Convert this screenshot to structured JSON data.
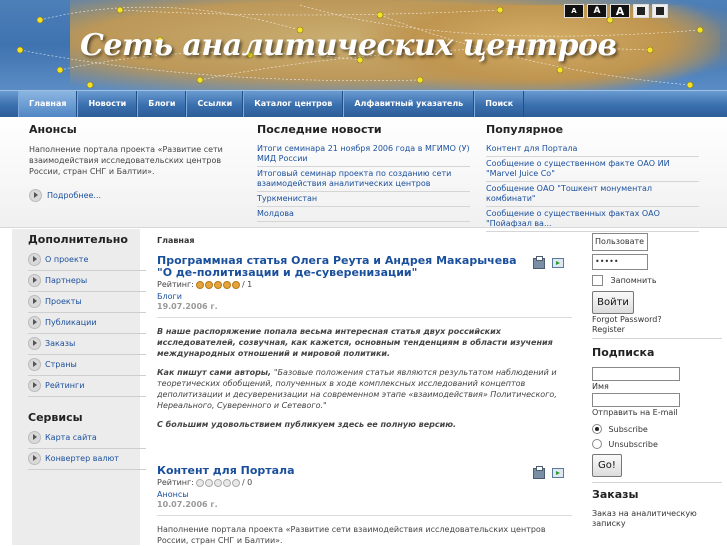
{
  "header": {
    "site_title": "Сеть аналитических центров",
    "font_tools": [
      "A",
      "A",
      "A"
    ]
  },
  "nav": {
    "items": [
      "Главная",
      "Новости",
      "Блоги",
      "Ссылки",
      "Каталог центров",
      "Алфавитный указатель",
      "Поиск"
    ],
    "active": "Главная"
  },
  "topband": {
    "announcements": {
      "title": "Анонсы",
      "text": "Наполнение портала проекта «Развитие сети взаимодействия исследовательских центров России, стран СНГ и Балтии».",
      "more": "Подробнее..."
    },
    "news": {
      "title": "Последние новости",
      "items": [
        "Итоги семинара 21 ноября 2006 года в МГИМО (У) МИД России",
        "Итоговый семинар проекта по созданию сети взаимодействия аналитических центров",
        "Туркменистан",
        "Молдова"
      ]
    },
    "popular": {
      "title": "Популярное",
      "items": [
        "Контент для Портала",
        "Сообщение о существенном факте ОАО ИИ \"Marvel Juice Co\"",
        "Сообщение ОАО \"Тошкент монументал комбинати\"",
        "Сообщение о существенных фактах ОАО \"Пойафзал ва..."
      ]
    }
  },
  "leftcol": {
    "additional": {
      "title": "Дополнительно",
      "items": [
        "О проекте",
        "Партнеры",
        "Проекты",
        "Публикации",
        "Заказы",
        "Страны",
        "Рейтинги"
      ]
    },
    "services": {
      "title": "Сервисы",
      "items": [
        "Карта сайта",
        "Конвертер валют"
      ]
    }
  },
  "main": {
    "breadcrumb": "Главная",
    "articles": [
      {
        "title": "Программная статья Олега Реута и Андрея Макарычева \"О де-политизации и де-суверенизации\"",
        "rating_label": "Рейтинг:",
        "rating_stars": 5,
        "rating_text": "/ 1",
        "category": "Блоги",
        "date": "19.07.2006 г.",
        "lead": "В наше распоряжение попала весьма интересная статья двух российских исследователей, созвучная, как кажется, основным тенденциям в области изучения международных отношений и мировой политики.",
        "quote_intro": "Как пишут сами авторы, ",
        "quote": "\"Базовые положения статьи являются результатом наблюдений и теоретических обобщений, полученных в ходе комплексных исследований концептов деполитизации и десуверенизации на современном этапе «взаимодействия» Политического, Нереального, Суверенного и Сетевого.\"",
        "closing": "С большим удовольствием публикуем здесь ее полную версию."
      },
      {
        "title": "Контент для Портала",
        "rating_label": "Рейтинг:",
        "rating_stars": 0,
        "rating_text": "/ 0",
        "category": "Анонсы",
        "date": "10.07.2006 г.",
        "body": "Наполнение портала проекта «Развитие сети взаимодействия исследовательских центров России, стран СНГ и Балтии»."
      }
    ]
  },
  "rightcol": {
    "login": {
      "username_value": "Пользовате",
      "password_value": "•••••",
      "remember_label": "Запомнить",
      "login_button": "Войти",
      "forgot": "Forgot Password?",
      "register": "Register"
    },
    "subscribe": {
      "title": "Подписка",
      "name_label": "Имя",
      "email_label": "Отправить на E-mail",
      "subscribe_label": "Subscribe",
      "unsubscribe_label": "Unsubscribe",
      "go_button": "Go!"
    },
    "orders": {
      "title": "Заказы",
      "link": "Заказ на аналитическую записку"
    }
  }
}
